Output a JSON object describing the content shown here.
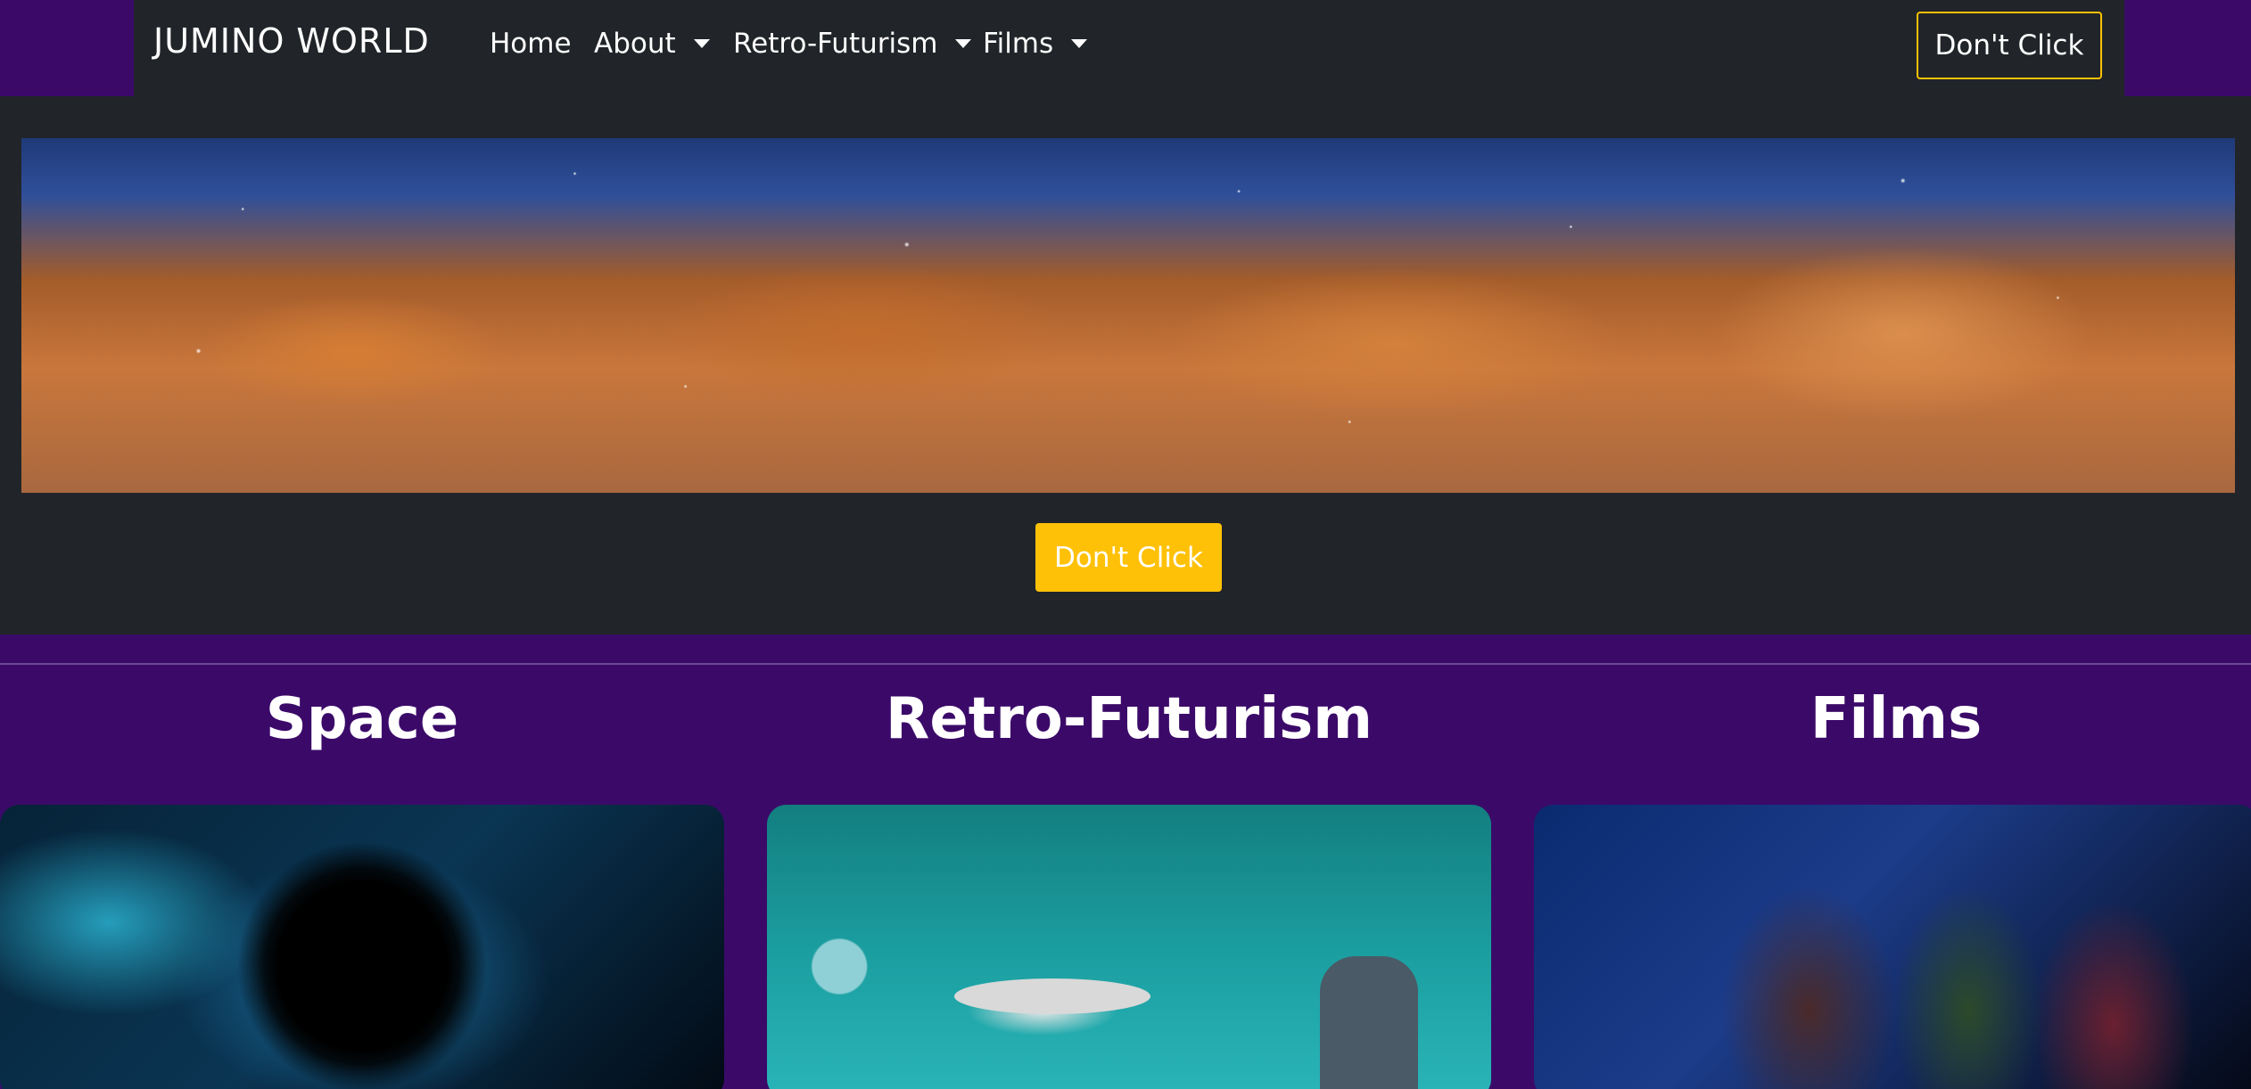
{
  "nav": {
    "brand": "JUMINO WORLD",
    "links": [
      {
        "label": "Home",
        "dropdown": false
      },
      {
        "label": "About",
        "dropdown": true
      },
      {
        "label": "Retro-Futurism",
        "dropdown": true
      },
      {
        "label": "Films",
        "dropdown": true
      }
    ],
    "cta_label": "Don't Click"
  },
  "hero": {
    "button_label": "Don't Click"
  },
  "sections": [
    {
      "title": "Space"
    },
    {
      "title": "Retro-Futurism"
    },
    {
      "title": "Films"
    }
  ],
  "colors": {
    "page_background": "#3b0a69",
    "navbar": "#212529",
    "accent": "#ffc107",
    "text": "#ffffff"
  }
}
